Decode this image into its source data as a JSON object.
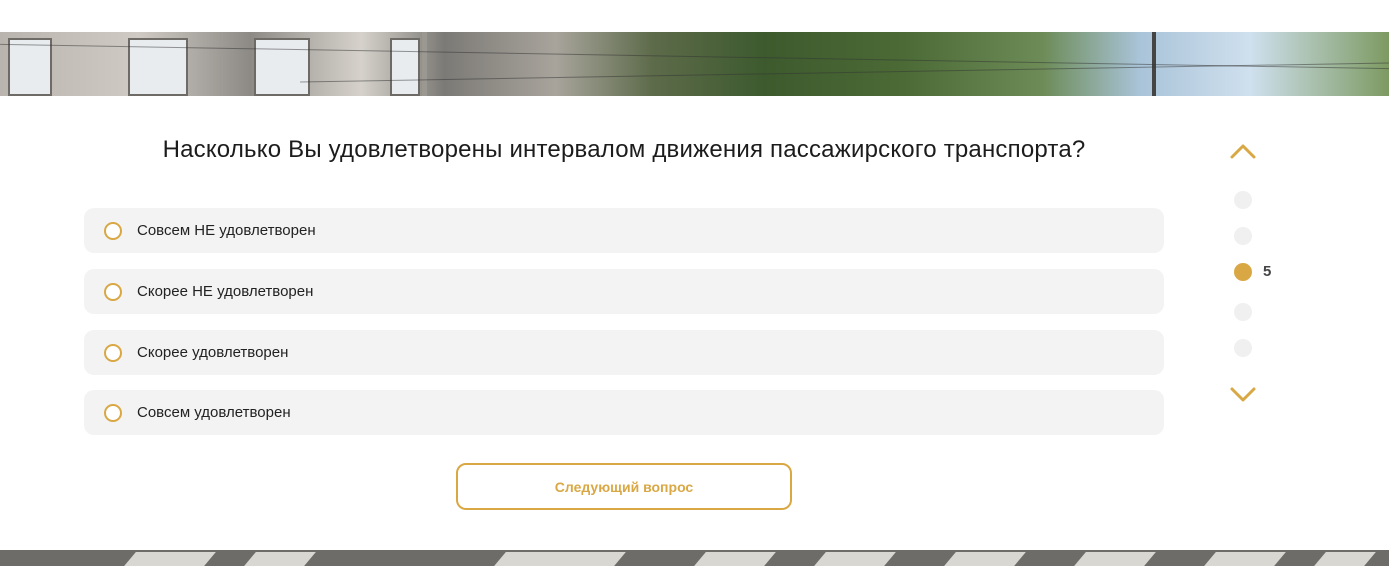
{
  "question": {
    "text": "Насколько Вы удовлетворены интервалом движения пассажирского транспорта?"
  },
  "options": [
    {
      "label": "Совсем НЕ удовлетворен",
      "selected": false
    },
    {
      "label": "Скорее НЕ удовлетворен",
      "selected": false
    },
    {
      "label": "Скорее удовлетворен",
      "selected": false
    },
    {
      "label": "Совсем удовлетворен",
      "selected": false
    }
  ],
  "next_button": {
    "label": "Следующий вопрос"
  },
  "pager": {
    "current": "5",
    "active_index": 2,
    "dots_count": 5
  },
  "colors": {
    "accent": "#d9a845",
    "option_bg": "#f3f3f3",
    "dot_inactive": "#f0f0f0"
  },
  "icons": {
    "up": "chevron-up-icon",
    "down": "chevron-down-icon",
    "radio": "radio-circle-icon"
  }
}
